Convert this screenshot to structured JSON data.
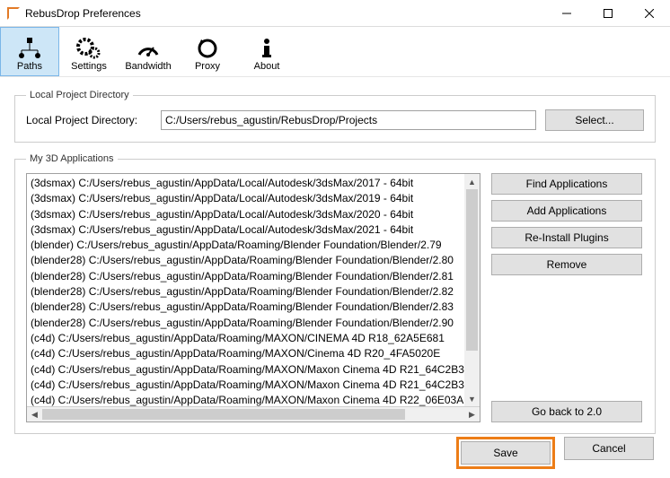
{
  "window": {
    "title": "RebusDrop Preferences"
  },
  "toolbar": {
    "paths": "Paths",
    "settings": "Settings",
    "bandwidth": "Bandwidth",
    "proxy": "Proxy",
    "about": "About"
  },
  "localProject": {
    "legend": "Local Project Directory",
    "label": "Local Project Directory:",
    "value": "C:/Users/rebus_agustin/RebusDrop/Projects",
    "selectBtn": "Select..."
  },
  "apps": {
    "legend": "My 3D Applications",
    "items": [
      "(3dsmax) C:/Users/rebus_agustin/AppData/Local/Autodesk/3dsMax/2017 - 64bit",
      "(3dsmax) C:/Users/rebus_agustin/AppData/Local/Autodesk/3dsMax/2019 - 64bit",
      "(3dsmax) C:/Users/rebus_agustin/AppData/Local/Autodesk/3dsMax/2020 - 64bit",
      "(3dsmax) C:/Users/rebus_agustin/AppData/Local/Autodesk/3dsMax/2021 - 64bit",
      "(blender) C:/Users/rebus_agustin/AppData/Roaming/Blender Foundation/Blender/2.79",
      "(blender28) C:/Users/rebus_agustin/AppData/Roaming/Blender Foundation/Blender/2.80",
      "(blender28) C:/Users/rebus_agustin/AppData/Roaming/Blender Foundation/Blender/2.81",
      "(blender28) C:/Users/rebus_agustin/AppData/Roaming/Blender Foundation/Blender/2.82",
      "(blender28) C:/Users/rebus_agustin/AppData/Roaming/Blender Foundation/Blender/2.83",
      "(blender28) C:/Users/rebus_agustin/AppData/Roaming/Blender Foundation/Blender/2.90",
      "(c4d) C:/Users/rebus_agustin/AppData/Roaming/MAXON/CINEMA 4D R18_62A5E681",
      "(c4d) C:/Users/rebus_agustin/AppData/Roaming/MAXON/Cinema 4D R20_4FA5020E",
      "(c4d) C:/Users/rebus_agustin/AppData/Roaming/MAXON/Maxon Cinema 4D R21_64C2B3",
      "(c4d) C:/Users/rebus_agustin/AppData/Roaming/MAXON/Maxon Cinema 4D R21_64C2B3",
      "(c4d) C:/Users/rebus_agustin/AppData/Roaming/MAXON/Maxon Cinema 4D R22_06E03A"
    ],
    "buttons": {
      "find": "Find Applications",
      "add": "Add Applications",
      "reinstall": "Re-Install Plugins",
      "remove": "Remove",
      "goback": "Go back to 2.0"
    }
  },
  "footer": {
    "save": "Save",
    "cancel": "Cancel"
  }
}
